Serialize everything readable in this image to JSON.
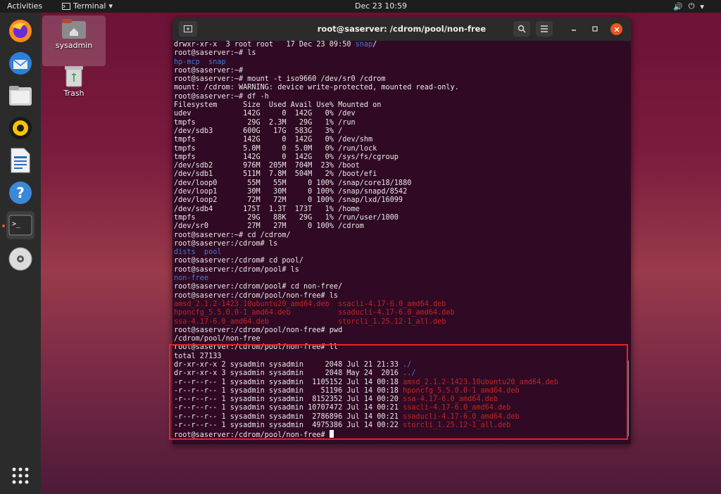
{
  "topbar": {
    "activities": "Activities",
    "app_label": "Terminal",
    "clock": "Dec 23  10:59"
  },
  "desktop": {
    "home_label": "sysadmin",
    "trash_label": "Trash"
  },
  "dock": {
    "items": [
      "firefox-icon",
      "thunderbird-icon",
      "files-icon",
      "rhythmbox-icon",
      "writer-icon",
      "help-icon",
      "terminal-icon",
      "dvd-icon"
    ],
    "apps_grid": "show-applications-icon"
  },
  "terminal": {
    "title": "root@saserver: /cdrom/pool/non-free",
    "lines": [
      [
        [
          "drwxr-xr-x  3 root root   17 Dec 23 09:50 ",
          "n"
        ],
        [
          "snap",
          "b"
        ],
        [
          "/",
          "n"
        ]
      ],
      [
        [
          "root@saserver:~# ls",
          "n"
        ]
      ],
      [
        [
          "hp-mcp  snap",
          "b"
        ]
      ],
      [
        [
          "root@saserver:~#",
          "n"
        ]
      ],
      [
        [
          "root@saserver:~# mount -t iso9660 /dev/sr0 /cdrom",
          "n"
        ]
      ],
      [
        [
          "mount: /cdrom: WARNING: device write-protected, mounted read-only.",
          "n"
        ]
      ],
      [
        [
          "root@saserver:~# df -h",
          "n"
        ]
      ],
      [
        [
          "Filesystem      Size  Used Avail Use% Mounted on",
          "n"
        ]
      ],
      [
        [
          "udev            142G     0  142G   0% /dev",
          "n"
        ]
      ],
      [
        [
          "tmpfs            29G  2.3M   29G   1% /run",
          "n"
        ]
      ],
      [
        [
          "/dev/sdb3       600G   17G  583G   3% /",
          "n"
        ]
      ],
      [
        [
          "tmpfs           142G     0  142G   0% /dev/shm",
          "n"
        ]
      ],
      [
        [
          "tmpfs           5.0M     0  5.0M   0% /run/lock",
          "n"
        ]
      ],
      [
        [
          "tmpfs           142G     0  142G   0% /sys/fs/cgroup",
          "n"
        ]
      ],
      [
        [
          "/dev/sdb2       976M  205M  704M  23% /boot",
          "n"
        ]
      ],
      [
        [
          "/dev/sdb1       511M  7.8M  504M   2% /boot/efi",
          "n"
        ]
      ],
      [
        [
          "/dev/loop0       55M   55M     0 100% /snap/core18/1880",
          "n"
        ]
      ],
      [
        [
          "/dev/loop1       30M   30M     0 100% /snap/snapd/8542",
          "n"
        ]
      ],
      [
        [
          "/dev/loop2       72M   72M     0 100% /snap/lxd/16099",
          "n"
        ]
      ],
      [
        [
          "/dev/sdb4       175T  1.3T  173T   1% /home",
          "n"
        ]
      ],
      [
        [
          "tmpfs            29G   88K   29G   1% /run/user/1000",
          "n"
        ]
      ],
      [
        [
          "/dev/sr0         27M   27M     0 100% /cdrom",
          "n"
        ]
      ],
      [
        [
          "root@saserver:~# cd /cdrom/",
          "n"
        ]
      ],
      [
        [
          "root@saserver:/cdrom# ls",
          "n"
        ]
      ],
      [
        [
          "dists  pool",
          "b"
        ]
      ],
      [
        [
          "root@saserver:/cdrom# cd pool/",
          "n"
        ]
      ],
      [
        [
          "root@saserver:/cdrom/pool# ls",
          "n"
        ]
      ],
      [
        [
          "non-free",
          "b"
        ]
      ],
      [
        [
          "root@saserver:/cdrom/pool# cd non-free/",
          "n"
        ]
      ],
      [
        [
          "root@saserver:/cdrom/pool/non-free# ls",
          "n"
        ]
      ],
      [
        [
          "amsd_2.1.2-1423.10ubuntu20_amd64.deb",
          "r"
        ],
        [
          "  ",
          "n"
        ],
        [
          "ssacli-4.17-6.0_amd64.deb",
          "r"
        ]
      ],
      [
        [
          "hponcfg_5.5.0.0-1_amd64.deb",
          "r"
        ],
        [
          "           ",
          "n"
        ],
        [
          "ssaducli-4.17-6.0_amd64.deb",
          "r"
        ]
      ],
      [
        [
          "ssa-4.17-6.0_amd64.deb",
          "r"
        ],
        [
          "                ",
          "n"
        ],
        [
          "storcli_1.25.12-1_all.deb",
          "r"
        ]
      ],
      [
        [
          "root@saserver:/cdrom/pool/non-free# pwd",
          "n"
        ]
      ],
      [
        [
          "/cdrom/pool/non-free",
          "n"
        ]
      ],
      [
        [
          "root@saserver:/cdrom/pool/non-free# ll",
          "n"
        ]
      ],
      [
        [
          "total 27133",
          "n"
        ]
      ],
      [
        [
          "dr-xr-xr-x 2 sysadmin sysadmin     2048 Jul 21 21:33 ",
          "n"
        ],
        [
          "./",
          "b"
        ]
      ],
      [
        [
          "dr-xr-xr-x 3 sysadmin sysadmin     2048 May 24  2016 ",
          "n"
        ],
        [
          "../",
          "b"
        ]
      ],
      [
        [
          "-r--r--r-- 1 sysadmin sysadmin  1105152 Jul 14 00:18 ",
          "n"
        ],
        [
          "amsd_2.1.2-1423.10ubuntu20_amd64.deb",
          "r"
        ]
      ],
      [
        [
          "-r--r--r-- 1 sysadmin sysadmin    51196 Jul 14 00:18 ",
          "n"
        ],
        [
          "hponcfg_5.5.0.0-1_amd64.deb",
          "r"
        ]
      ],
      [
        [
          "-r--r--r-- 1 sysadmin sysadmin  8152352 Jul 14 00:20 ",
          "n"
        ],
        [
          "ssa-4.17-6.0_amd64.deb",
          "r"
        ]
      ],
      [
        [
          "-r--r--r-- 1 sysadmin sysadmin 10707472 Jul 14 00:21 ",
          "n"
        ],
        [
          "ssacli-4.17-6.0_amd64.deb",
          "r"
        ]
      ],
      [
        [
          "-r--r--r-- 1 sysadmin sysadmin  2786896 Jul 14 00:21 ",
          "n"
        ],
        [
          "ssaducli-4.17-6.0_amd64.deb",
          "r"
        ]
      ],
      [
        [
          "-r--r--r-- 1 sysadmin sysadmin  4975386 Jul 14 00:22 ",
          "n"
        ],
        [
          "storcli_1.25.12-1_all.deb",
          "r"
        ]
      ],
      [
        [
          "root@saserver:/cdrom/pool/non-free# ",
          "n"
        ],
        [
          "",
          "cursor"
        ]
      ]
    ]
  },
  "colors": {
    "terminal_bg": "#300a24",
    "dir_blue": "#3b7bd6",
    "deb_red": "#c32424",
    "highlight_box": "#e0262a",
    "accent_orange": "#e95420"
  }
}
